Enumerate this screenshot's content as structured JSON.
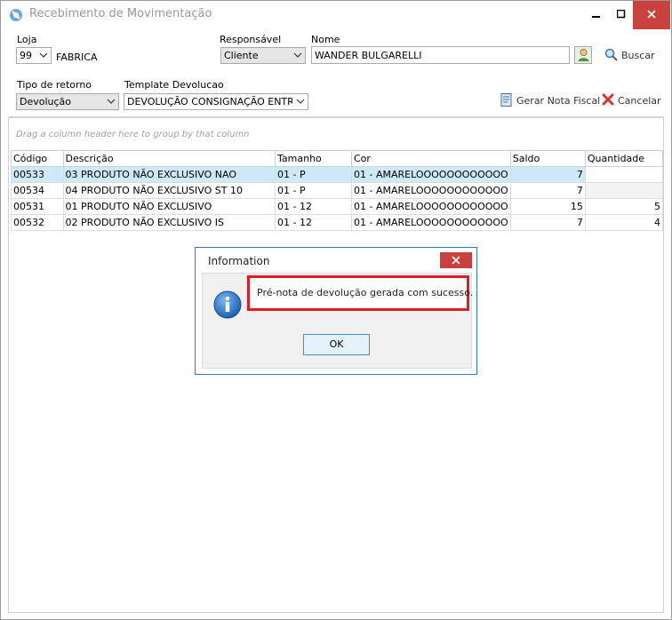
{
  "window": {
    "title": "Recebimento de Movimentação",
    "icon": "app-logo-icon"
  },
  "form": {
    "loja_label": "Loja",
    "loja_value": "99",
    "loja_name": "FABRICA",
    "responsavel_label": "Responsável",
    "responsavel_value": "Cliente",
    "nome_label": "Nome",
    "nome_value": "WANDER BULGARELLI",
    "buscar_label": "Buscar",
    "tipo_retorno_label": "Tipo de retorno",
    "tipo_retorno_value": "Devolução",
    "template_label": "Template Devolucao",
    "template_value": "DEVOLUÇÃO CONSIGNAÇÃO ENTRADA",
    "gerar_label": "Gerar Nota Fiscal",
    "cancelar_label": "Cancelar"
  },
  "grid": {
    "group_hint": "Drag a column header here to group by that column",
    "columns": [
      "Código",
      "Descrição",
      "Tamanho",
      "Cor",
      "Saldo",
      "Quantidade"
    ],
    "rows": [
      {
        "codigo": "00533",
        "descricao": "03 PRODUTO NÃO EXCLUSIVO NAO",
        "tamanho": "01 - P",
        "cor": "01 - AMARELOOOOOOOOOOOO",
        "saldo": "7",
        "quantidade": ""
      },
      {
        "codigo": "00534",
        "descricao": "04 PRODUTO NÃO EXCLUSIVO ST 10",
        "tamanho": "01 - P",
        "cor": "01 - AMARELOOOOOOOOOOOO",
        "saldo": "7",
        "quantidade": ""
      },
      {
        "codigo": "00531",
        "descricao": "01 PRODUTO NÃO EXCLUSIVO",
        "tamanho": "01 - 12",
        "cor": "01 - AMARELOOOOOOOOOOOO",
        "saldo": "15",
        "quantidade": "5"
      },
      {
        "codigo": "00532",
        "descricao": "02 PRODUTO NÃO EXCLUSIVO IS",
        "tamanho": "01 - 12",
        "cor": "01 - AMARELOOOOOOOOOOOO",
        "saldo": "7",
        "quantidade": "4"
      }
    ]
  },
  "dialog": {
    "title": "Information",
    "message": "Pré-nota de devolução gerada com sucesso.",
    "ok_label": "OK",
    "highlight_color": "#e01b24"
  }
}
